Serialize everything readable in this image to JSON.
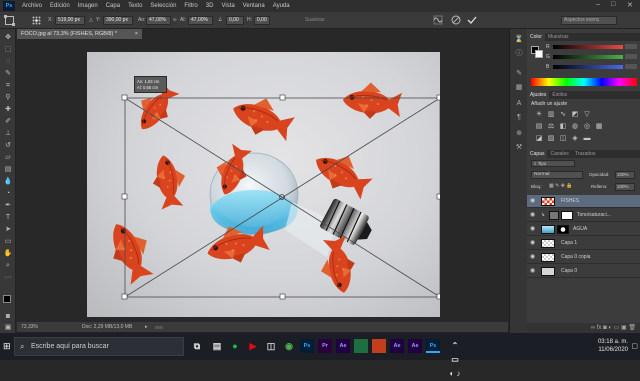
{
  "app": {
    "logo": "Ps"
  },
  "menu": [
    "Archivo",
    "Edición",
    "Imagen",
    "Capa",
    "Texto",
    "Selección",
    "Filtro",
    "3D",
    "Vista",
    "Ventana",
    "Ayuda"
  ],
  "window_controls": {
    "minimize": "–",
    "maximize": "□",
    "close": "✕"
  },
  "options": {
    "x_label": "X:",
    "x_value": "519,00 px",
    "y_label": "Y:",
    "y_value": "390,00 px",
    "w_label": "An:",
    "w_value": "47,00%",
    "h_label": "Al:",
    "h_value": "47,00%",
    "angle_value": "0,00",
    "h_skew_label": "H:",
    "h_skew_value": "0,00",
    "interp_label": "Suavizar",
    "workspace_label": "Aspectos esenc.",
    "cancel_icon": "cancel-icon",
    "commit_icon": "commit-check-icon"
  },
  "document": {
    "tab_title": "FOCO.jpg al 73,3% (FISHES, RGB/8) *",
    "transform_tooltip_w": "An: 1,63 cm",
    "transform_tooltip_h": "Al: 0,65 cm",
    "zoom": "73,33%",
    "doc_size": "Doc: 2,29 MB/13,0 MB",
    "timeline_label": "Línea de tiempo"
  },
  "color_panel": {
    "tabs": [
      "Color",
      "Muestras"
    ],
    "active_tab": "Color",
    "r_color": "#e84a4a",
    "g_color": "#4ab04a",
    "b_color": "#4a6ae8"
  },
  "adjust_panel": {
    "tabs": [
      "Ajustes",
      "Estilos"
    ],
    "active_tab": "Ajustes",
    "heading": "Añadir un ajuste"
  },
  "layers_panel": {
    "tabs": [
      "Capas",
      "Canales",
      "Trazados"
    ],
    "active_tab": "Capas",
    "filter_label": "Tipo",
    "blend_mode": "Normal",
    "opacity_label": "Opacidad:",
    "opacity_value": "100%",
    "lock_label": "Bloq.:",
    "fill_label": "Relleno:",
    "fill_value": "100%",
    "layers": [
      {
        "name": "FISHES",
        "selected": true
      },
      {
        "name": "Tono/saturaci...",
        "selected": false
      },
      {
        "name": "AGUA",
        "selected": false
      },
      {
        "name": "Capa 1",
        "selected": false
      },
      {
        "name": "Capa 0 copia",
        "selected": false
      },
      {
        "name": "Capa 0",
        "selected": false
      }
    ]
  },
  "taskbar": {
    "search_placeholder": "Escribe aquí para buscar",
    "apps": [
      "Ps",
      "Pr",
      "Ae",
      "X",
      "P",
      "Ae",
      "Ae",
      "Ps"
    ],
    "app_colors": [
      "#31a8ff",
      "#9999ff",
      "#9999ff",
      "#1d6f42",
      "#c43e1c",
      "#9999ff",
      "#9999ff",
      "#31a8ff"
    ],
    "time": "03:18 a. m.",
    "date": "11/06/2020"
  },
  "colors": {
    "accent": "#31a8ff",
    "fish": "#d9431e",
    "water": "#7fd4f0"
  }
}
